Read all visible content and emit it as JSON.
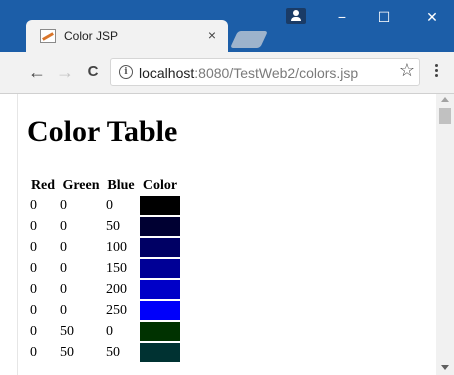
{
  "browser": {
    "tab": {
      "title": "Color JSP",
      "close": "×"
    },
    "window_controls": {
      "minimize": "−",
      "maximize": "☐",
      "close": "✕"
    },
    "nav": {
      "back": "←",
      "forward": "→",
      "reload": "C"
    },
    "address": {
      "host": "localhost",
      "rest": ":8080/TestWeb2/colors.jsp"
    },
    "bookmark": "☆"
  },
  "page": {
    "heading": "Color Table",
    "headers": [
      "Red",
      "Green",
      "Blue",
      "Color"
    ],
    "rows": [
      {
        "red": "0",
        "green": "0",
        "blue": "0",
        "color": "#000000"
      },
      {
        "red": "0",
        "green": "0",
        "blue": "50",
        "color": "#000032"
      },
      {
        "red": "0",
        "green": "0",
        "blue": "100",
        "color": "#000064"
      },
      {
        "red": "0",
        "green": "0",
        "blue": "150",
        "color": "#000096"
      },
      {
        "red": "0",
        "green": "0",
        "blue": "200",
        "color": "#0000c8"
      },
      {
        "red": "0",
        "green": "0",
        "blue": "250",
        "color": "#0000fa"
      },
      {
        "red": "0",
        "green": "50",
        "blue": "0",
        "color": "#003200"
      },
      {
        "red": "0",
        "green": "50",
        "blue": "50",
        "color": "#003232"
      }
    ]
  },
  "colors": {
    "titlebar": "#1c5ea8",
    "toolbar": "#f2f2f2"
  }
}
